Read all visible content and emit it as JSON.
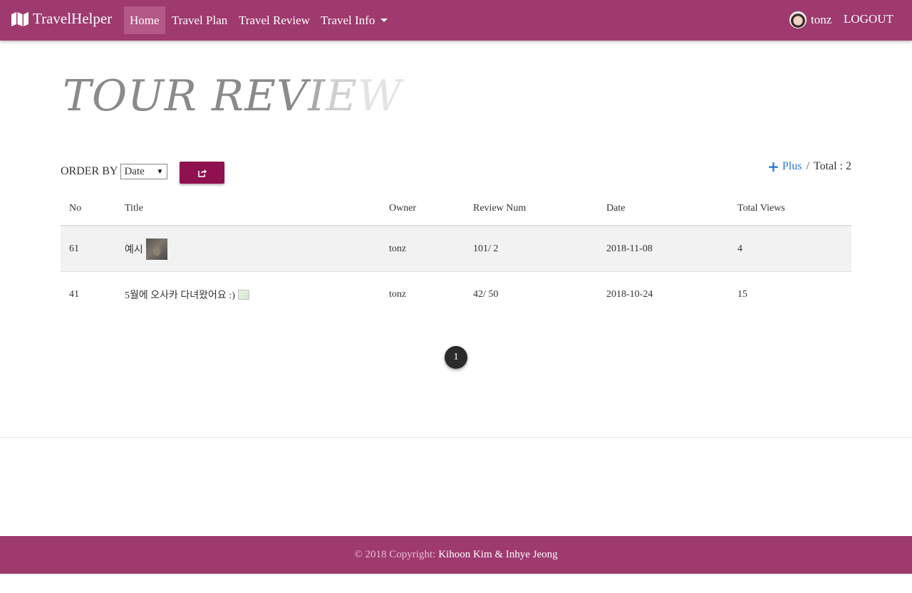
{
  "navbar": {
    "brand": "TravelHelper",
    "links": [
      {
        "label": "Home"
      },
      {
        "label": "Travel Plan"
      },
      {
        "label": "Travel Review"
      },
      {
        "label": "Travel Info"
      }
    ],
    "username": "tonz",
    "logout": "LOGOUT",
    "color": "#9e3a6e"
  },
  "page": {
    "title_part1": "TOUR REV",
    "title_part2": "I",
    "title_part3": "E",
    "title_part4": "W"
  },
  "controls": {
    "order_by_label": "ORDER BY",
    "order_selected": "Date",
    "plus_label": "Plus",
    "separator": "/",
    "total_label": "Total : 2"
  },
  "table": {
    "headers": [
      "No",
      "Title",
      "Owner",
      "Review Num",
      "Date",
      "Total Views"
    ],
    "rows": [
      {
        "no": "61",
        "title": "예시",
        "owner": "tonz",
        "review_num": "101/ 2",
        "date": "2018-11-08",
        "views": "4"
      },
      {
        "no": "41",
        "title": "5월에 오사카 다녀왔어요 :)",
        "owner": "tonz",
        "review_num": "42/ 50",
        "date": "2018-10-24",
        "views": "15"
      }
    ]
  },
  "pagination": {
    "current": "1"
  },
  "footer": {
    "copyright": "© 2018 Copyright:",
    "authors": "Kihoon Kim & Inhye Jeong"
  }
}
